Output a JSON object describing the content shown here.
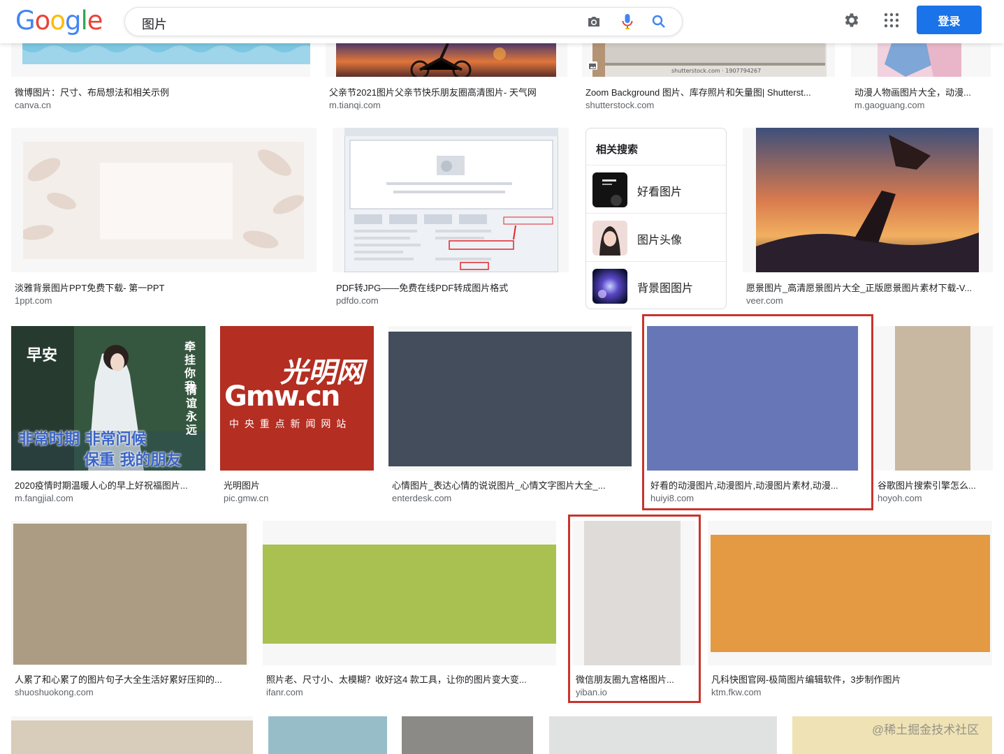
{
  "header": {
    "logo": [
      "G",
      "o",
      "o",
      "g",
      "l",
      "e"
    ],
    "logo_colors": [
      "#4285f4",
      "#ea4335",
      "#fbbc05",
      "#4285f4",
      "#34a853",
      "#ea4335"
    ],
    "query": "图片",
    "login": "登录"
  },
  "related": {
    "title": "相关搜索",
    "items": [
      {
        "label": "好看图片"
      },
      {
        "label": "图片头像"
      },
      {
        "label": "背景图图片"
      }
    ]
  },
  "row1": [
    {
      "title": "微博图片：尺寸、布局想法和相关示例",
      "domain": "canva.cn"
    },
    {
      "title": "父亲节2021图片父亲节快乐朋友圈高清图片- 天气网",
      "domain": "m.tianqi.com"
    },
    {
      "title": "Zoom Background 图片、库存照片和矢量图| Shutterst...",
      "domain": "shutterstock.com",
      "overlay": "shutterstock.com · 1907794267"
    },
    {
      "title": "动漫人物画图片大全，动漫...",
      "domain": "m.gaoguang.com"
    }
  ],
  "row2": [
    {
      "title": "淡雅背景图片PPT免费下载- 第一PPT",
      "domain": "1ppt.com"
    },
    {
      "title": "PDF转JPG——免费在线PDF转成图片格式",
      "domain": "pdfdo.com"
    },
    {
      "title": "愿景图片_高清愿景图片大全_正版愿景图片素材下载-V...",
      "domain": "veer.com"
    }
  ],
  "row3": [
    {
      "title": "2020疫情时期温暖人心的早上好祝福图片...",
      "domain": "m.fangjial.com",
      "poster": {
        "top_left": "早安",
        "right_a": "牵挂你我",
        "right_b": "情谊永远",
        "line1": "非常时期 非常问候",
        "line2": "保重 我的朋友"
      }
    },
    {
      "title": "光明图片",
      "domain": "pic.gmw.cn",
      "logo_script": "光明网",
      "logo_word": "Gmw.cn",
      "logo_sub": "中 央 重 点 新 闻 网 站"
    },
    {
      "title": "心情图片_表达心情的说说图片_心情文字图片大全_...",
      "domain": "enterdesk.com",
      "color": "#434d5c"
    },
    {
      "title": "好看的动漫图片,动漫图片,动漫图片素材,动漫...",
      "domain": "huiyi8.com",
      "color": "#6776b6"
    },
    {
      "title": "谷歌图片搜索引擎怎么...",
      "domain": "hoyoh.com",
      "color": "#c8b8a2"
    }
  ],
  "row4": [
    {
      "title": "人累了和心累了的图片句子大全生活好累好压抑的...",
      "domain": "shuoshuokong.com",
      "color": "#ab9c83"
    },
    {
      "title": "照片老、尺寸小、太模糊？收好这4 款工具，让你的图片变大变...",
      "domain": "ifanr.com",
      "color": "#a8c151"
    },
    {
      "title": "微信朋友圈九宫格图片...",
      "domain": "yiban.io",
      "color": "#dedbd9"
    },
    {
      "title": "凡科快图官网-极简图片编辑软件，3步制作图片",
      "domain": "ktm.fkw.com",
      "color": "#e39a43"
    }
  ],
  "row5_colors": [
    "#d8ccba",
    "#97bec8",
    "#8b8a86",
    "#e0e2e1",
    "#efe2b4"
  ],
  "watermark": "@稀土掘金技术社区"
}
